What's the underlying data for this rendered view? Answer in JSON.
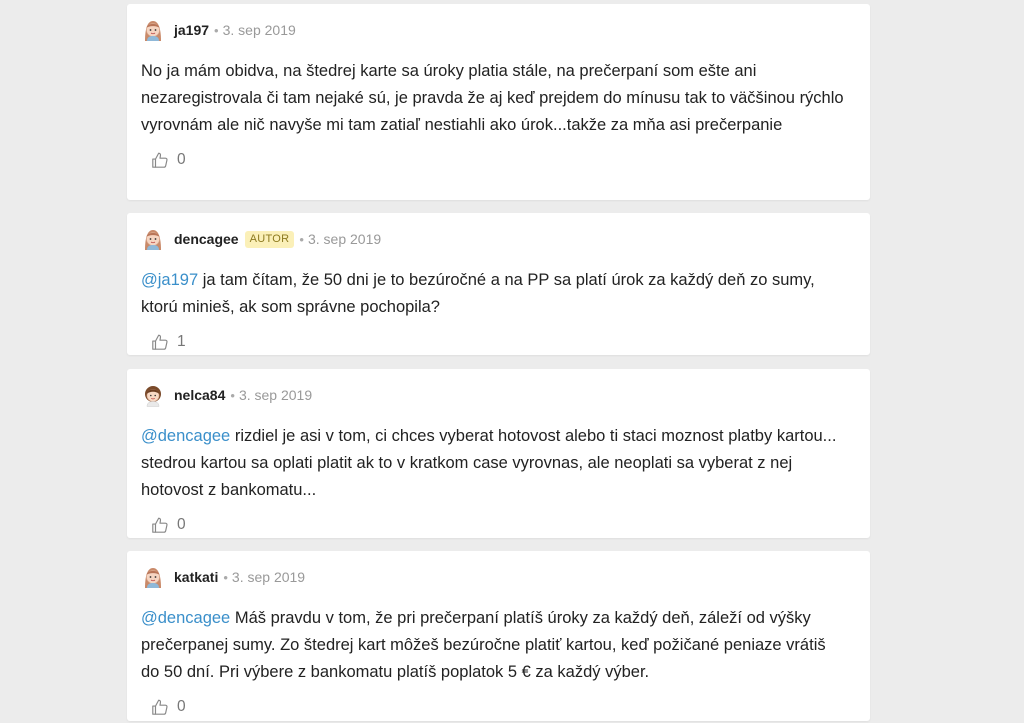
{
  "comments": [
    {
      "user": "ja197",
      "badge": "",
      "separator": "•",
      "date": "3. sep 2019",
      "mention": "",
      "text": "No ja mám obidva, na štedrej karte sa úroky platia stále, na prečerpaní som ešte ani nezaregistrovala či tam nejaké sú, je pravda že aj keď prejdem do mínusu tak to väčšinou rýchlo vyrovnám ale nič navyše mi tam zatiaľ nestiahli ako úrok...takže za mňa asi prečerpanie",
      "likes": "0",
      "avatar": "girl-avatar-icon"
    },
    {
      "user": "dencagee",
      "badge": "AUTOR",
      "separator": "•",
      "date": "3. sep 2019",
      "mention": "@ja197",
      "text": " ja tam čítam, že 50 dni je to bezúročné a na PP sa platí úrok za každý deň zo sumy, ktorú minieš, ak som správne pochopila?",
      "likes": "1",
      "avatar": "girl-avatar-icon"
    },
    {
      "user": "nelca84",
      "badge": "",
      "separator": "•",
      "date": "3. sep 2019",
      "mention": "@dencagee",
      "text": " rizdiel je asi v tom, ci chces vyberat hotovost alebo ti staci moznost platby kartou... stedrou kartou sa oplati platit ak to v kratkom case vyrovnas, ale neoplati sa vyberat z nej hotovost z bankomatu...",
      "likes": "0",
      "avatar": "woman-avatar-icon"
    },
    {
      "user": "katkati",
      "badge": "",
      "separator": "•",
      "date": "3. sep 2019",
      "mention": "@dencagee",
      "text": " Máš pravdu v tom, že pri prečerpaní platíš úroky za každý deň, záleží od výšky prečerpanej sumy. Zo štedrej kart môžeš bezúročne platiť kartou, keď požičané peniaze vrátiš do 50 dní. Pri výbere z bankomatu platíš poplatok 5 € za každý výber.",
      "likes": "0",
      "avatar": "girl-avatar-icon"
    }
  ]
}
